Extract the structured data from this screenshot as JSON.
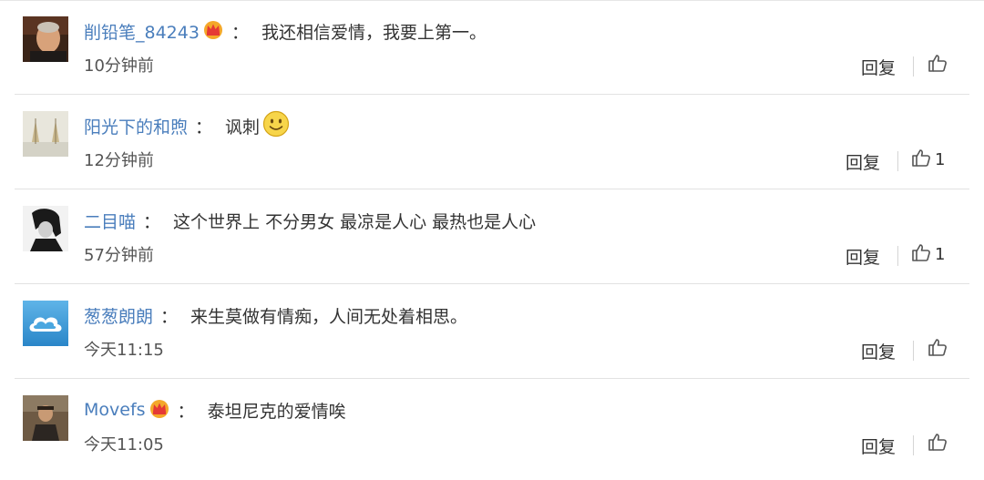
{
  "comments": [
    {
      "username": "削铅笔_84243",
      "crown": true,
      "colon": "：",
      "text": "我还相信爱情，我要上第一。",
      "time": "10分钟前",
      "reply_label": "回复",
      "like_count": "",
      "avatar": "man-portrait-avatar"
    },
    {
      "username": "阳光下的和煦",
      "crown": false,
      "colon": "：",
      "text": "讽刺",
      "smiley": true,
      "time": "12分钟前",
      "reply_label": "回复",
      "like_count": "1",
      "avatar": "sailboats-avatar"
    },
    {
      "username": "二目喵",
      "crown": false,
      "colon": "：",
      "text": "这个世界上 不分男女 最凉是人心 最热也是人心",
      "time": "57分钟前",
      "reply_label": "回复",
      "like_count": "1",
      "avatar": "bw-figure-avatar"
    },
    {
      "username": "葱葱朗朗",
      "crown": false,
      "colon": "：",
      "text": "来生莫做有情痴，人间无处着相思。",
      "time": "今天11:15",
      "reply_label": "回复",
      "like_count": "",
      "avatar": "blue-cloud-avatar"
    },
    {
      "username": "Movefs",
      "crown": true,
      "colon": "：",
      "text": "泰坦尼克的爱情唉",
      "time": "今天11:05",
      "reply_label": "回复",
      "like_count": "",
      "avatar": "man-photo-avatar"
    }
  ],
  "colors": {
    "username": "#4a7ebc",
    "separator": "#e2e2e2",
    "crown": "#f0a020"
  }
}
